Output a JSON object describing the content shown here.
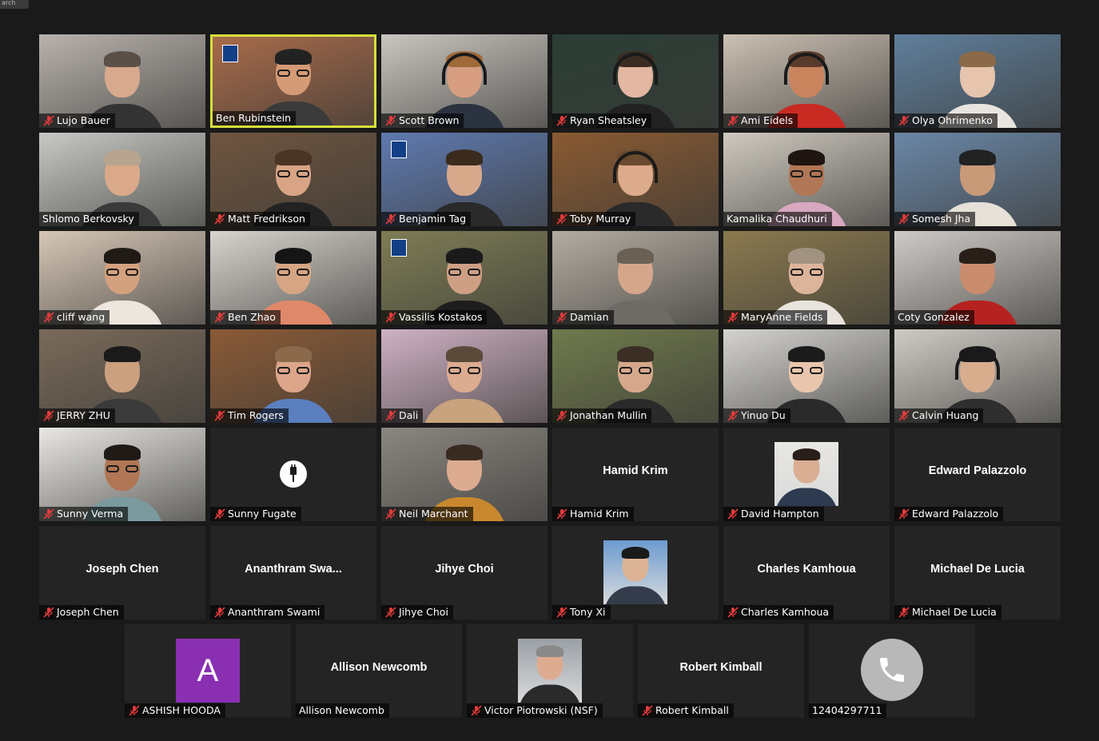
{
  "window": {
    "tab_label": "arch"
  },
  "meeting": {
    "active_speaker": "Ben Rubinstein"
  },
  "tiles": [
    {
      "name": "Lujo Bauer",
      "type": "video",
      "muted": true,
      "bg": "#b9b2ad",
      "skin": "#d7a98d",
      "hair": "#5b5048",
      "shirt": "#333",
      "glasses": false
    },
    {
      "name": "Ben Rubinstein",
      "type": "video",
      "muted": false,
      "active": true,
      "bg": "#a86b4a",
      "skin": "#d59a76",
      "hair": "#222",
      "shirt": "#3a3a3a",
      "glasses": true,
      "logo": true
    },
    {
      "name": "Scott Brown",
      "type": "video",
      "muted": true,
      "bg": "#c9c5bf",
      "skin": "#d79e82",
      "hair": "#a06a3a",
      "shirt": "#2b3340",
      "glasses": false,
      "headset": true
    },
    {
      "name": "Ryan Sheatsley",
      "type": "video",
      "muted": true,
      "bg": "#2a3e35",
      "skin": "#e3b7a2",
      "hair": "#3b2c22",
      "shirt": "#222",
      "glasses": false,
      "headset": true
    },
    {
      "name": "Ami Eidels",
      "type": "video",
      "muted": true,
      "bg": "#cbc0b3",
      "skin": "#c9845e",
      "hair": "#5a3a2a",
      "shirt": "#c92a22",
      "glasses": false,
      "headset": true
    },
    {
      "name": "Olya Ohrimenko",
      "type": "video",
      "muted": true,
      "bg": "#5f7f9c",
      "skin": "#e6c4ad",
      "hair": "#8a6a48",
      "shirt": "#e8e4df",
      "glasses": false
    },
    {
      "name": "Shlomo Berkovsky",
      "type": "video",
      "muted": false,
      "bg": "#c7c9c4",
      "skin": "#d9a98a",
      "hair": "#b7a58f",
      "shirt": "#3a3a3a",
      "glasses": false
    },
    {
      "name": "Matt Fredrikson",
      "type": "video",
      "muted": true,
      "bg": "#6f5540",
      "skin": "#d9a485",
      "hair": "#4a3424",
      "shirt": "#222",
      "glasses": true
    },
    {
      "name": "Benjamin Tag",
      "type": "video",
      "muted": true,
      "bg": "#5f7ab0",
      "skin": "#d8a88b",
      "hair": "#3b2b1e",
      "shirt": "#2a2a2a",
      "glasses": false,
      "logo": true
    },
    {
      "name": "Toby Murray",
      "type": "video",
      "muted": true,
      "bg": "#8a5a32",
      "skin": "#dcab8c",
      "hair": "#6a4a2e",
      "shirt": "#2a2a2a",
      "glasses": false,
      "headset": true
    },
    {
      "name": "Kamalika Chaudhuri",
      "type": "video",
      "muted": false,
      "bg": "#cfcac0",
      "skin": "#b07656",
      "hair": "#1e1410",
      "shirt": "#d8a8c0",
      "glasses": true
    },
    {
      "name": "Somesh Jha",
      "type": "video",
      "muted": true,
      "bg": "#6a87a7",
      "skin": "#c99a78",
      "hair": "#222",
      "shirt": "#e6e0d8",
      "glasses": false
    },
    {
      "name": "cliff wang",
      "type": "video",
      "muted": true,
      "bg": "#d6c6b6",
      "skin": "#d4a17f",
      "hair": "#1f1a16",
      "shirt": "#ece6de",
      "glasses": true
    },
    {
      "name": "Ben Zhao",
      "type": "video",
      "muted": true,
      "bg": "#d7d3cd",
      "skin": "#d6a584",
      "hair": "#151515",
      "shirt": "#e0886a",
      "glasses": true
    },
    {
      "name": "Vassilis Kostakos",
      "type": "video",
      "muted": true,
      "bg": "#7e7d55",
      "skin": "#cf9f84",
      "hair": "#1a1a1a",
      "shirt": "#1d1d1d",
      "glasses": true,
      "logo": true
    },
    {
      "name": "Damian",
      "type": "video",
      "muted": true,
      "bg": "#b3aca1",
      "skin": "#d6a68b",
      "hair": "#6a6054",
      "shirt": "#6e6a66",
      "glasses": false
    },
    {
      "name": "MaryAnne Fields",
      "type": "video",
      "muted": true,
      "bg": "#8b7a4f",
      "skin": "#dcb49a",
      "hair": "#a19281",
      "shirt": "#e8e3dc",
      "glasses": true
    },
    {
      "name": "Coty Gonzalez",
      "type": "video",
      "muted": false,
      "bg": "#cfcac6",
      "skin": "#c98c6d",
      "hair": "#2a1f18",
      "shirt": "#b5221f",
      "glasses": false
    },
    {
      "name": "JERRY ZHU",
      "type": "video",
      "muted": true,
      "bg": "#7a6a5a",
      "skin": "#caa07f",
      "hair": "#1a1a1a",
      "shirt": "#3a3a3a",
      "glasses": false
    },
    {
      "name": "Tim Rogers",
      "type": "video",
      "muted": true,
      "bg": "#8a5a36",
      "skin": "#dca58a",
      "hair": "#8a6a4a",
      "shirt": "#5b7fbf",
      "glasses": true
    },
    {
      "name": "Dali",
      "type": "video",
      "muted": true,
      "bg": "#cfb1c4",
      "skin": "#dcab90",
      "hair": "#5a4a3a",
      "shirt": "#c9a27e",
      "glasses": true
    },
    {
      "name": "Jonathan Mullin",
      "type": "video",
      "muted": true,
      "bg": "#6f7a4c",
      "skin": "#d6a88b",
      "hair": "#3a2e25",
      "shirt": "#2a2a2a",
      "glasses": true
    },
    {
      "name": "Yinuo Du",
      "type": "video",
      "muted": true,
      "bg": "#d5d3cf",
      "skin": "#e8c6ad",
      "hair": "#1b1b1b",
      "shirt": "#2a2a2a",
      "glasses": true
    },
    {
      "name": "Calvin Huang",
      "type": "video",
      "muted": true,
      "bg": "#cfcac4",
      "skin": "#d7ad8e",
      "hair": "#1a1a1a",
      "shirt": "#2e2e2e",
      "glasses": false,
      "headset": true
    },
    {
      "name": "Sunny Verma",
      "type": "video",
      "muted": true,
      "bg": "#e9e7e3",
      "skin": "#b07656",
      "hair": "#1f1a16",
      "shirt": "#7a9a9e",
      "glasses": true
    },
    {
      "name": "Sunny Fugate",
      "type": "cable",
      "muted": true
    },
    {
      "name": "Neil Marchant",
      "type": "video",
      "muted": true,
      "bg": "#8a8680",
      "skin": "#dcab90",
      "hair": "#3a2b22",
      "shirt": "#c9882e",
      "glasses": false
    },
    {
      "name": "Hamid Krim",
      "type": "text",
      "display": "Hamid Krim",
      "muted": true
    },
    {
      "name": "David Hampton",
      "type": "photo",
      "muted": true,
      "bg": "#e8e6e2",
      "skin": "#d9ae92",
      "hair": "#2a1f18",
      "shirt": "#2d3a50"
    },
    {
      "name": "Edward Palazzolo",
      "type": "text",
      "display": "Edward Palazzolo",
      "muted": true
    },
    {
      "name": "Joseph Chen",
      "type": "text",
      "display": "Joseph Chen",
      "muted": true
    },
    {
      "name": "Ananthram Swami",
      "type": "text",
      "display": "Ananthram  Swa...",
      "muted": true
    },
    {
      "name": "Jihye Choi",
      "type": "text",
      "display": "Jihye Choi",
      "muted": true
    },
    {
      "name": "Tony Xi",
      "type": "photo",
      "muted": true,
      "bg": "#6c9bd0",
      "skin": "#dcb394",
      "hair": "#1a1a1a",
      "shirt": "#333c4a"
    },
    {
      "name": "Charles Kamhoua",
      "type": "text",
      "display": "Charles Kamhoua",
      "muted": true
    },
    {
      "name": "Michael De Lucia",
      "type": "text",
      "display": "Michael De Lucia",
      "muted": true
    },
    {
      "name": "ASHISH HOODA",
      "type": "letter",
      "letter": "A",
      "muted": true
    },
    {
      "name": "Allison Newcomb",
      "type": "text",
      "display": "Allison Newcomb",
      "muted": false
    },
    {
      "name": "Victor Piotrowski (NSF)",
      "type": "photo",
      "muted": true,
      "bg": "#9aa0a6",
      "skin": "#dcab90",
      "hair": "#8a8a8a",
      "shirt": "#2a2a2a"
    },
    {
      "name": "Robert Kimball",
      "type": "text",
      "display": "Robert Kimball",
      "muted": true
    },
    {
      "name": "12404297711",
      "type": "phone",
      "muted": false
    }
  ]
}
